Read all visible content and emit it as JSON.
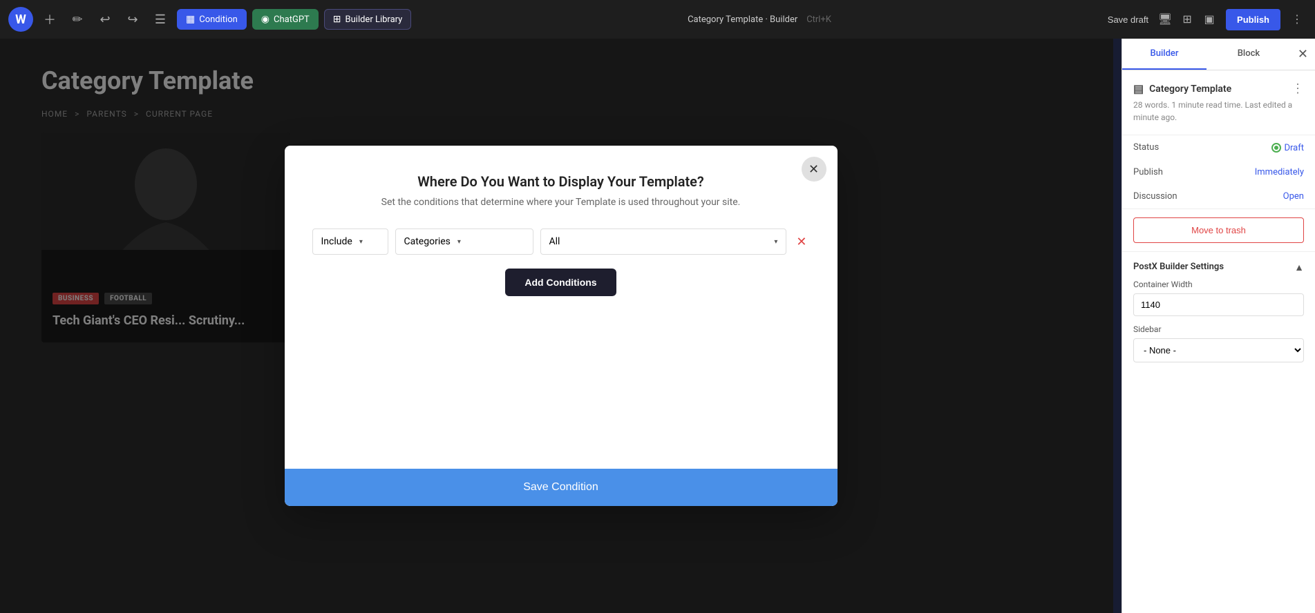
{
  "toolbar": {
    "logo_text": "W",
    "condition_label": "Condition",
    "chatgpt_label": "ChatGPT",
    "builder_library_label": "Builder Library",
    "page_title": "Category Template · Builder",
    "shortcut": "Ctrl+K",
    "save_draft_label": "Save draft",
    "publish_label": "Publish"
  },
  "breadcrumb": {
    "home": "HOME",
    "sep1": ">",
    "parents": "PARENTS",
    "sep2": ">",
    "current": "CURRENT PAGE"
  },
  "page": {
    "title": "Category Template",
    "article": {
      "tag1": "BUSINESS",
      "tag2": "FOOTBALL",
      "headline": "Tech Giant's CEO Resi... Scrutiny..."
    }
  },
  "sidebar": {
    "tab_builder": "Builder",
    "tab_block": "Block",
    "template_title": "Category Template",
    "template_meta": "28 words. 1 minute read time. Last edited a minute ago.",
    "status_label": "Status",
    "status_value": "Draft",
    "publish_label": "Publish",
    "publish_value": "Immediately",
    "discussion_label": "Discussion",
    "discussion_value": "Open",
    "move_trash_label": "Move to trash",
    "postx_section_title": "PostX Builder Settings",
    "container_width_label": "Container Width",
    "container_width_value": "1140",
    "sidebar_label": "Sidebar",
    "sidebar_value": "- None -"
  },
  "modal": {
    "title": "Where Do You Want to Display Your Template?",
    "subtitle": "Set the conditions that determine where your Template is used throughout your site.",
    "include_label": "Include",
    "categories_label": "Categories",
    "all_label": "All",
    "add_conditions_label": "Add Conditions",
    "save_condition_label": "Save Condition"
  }
}
